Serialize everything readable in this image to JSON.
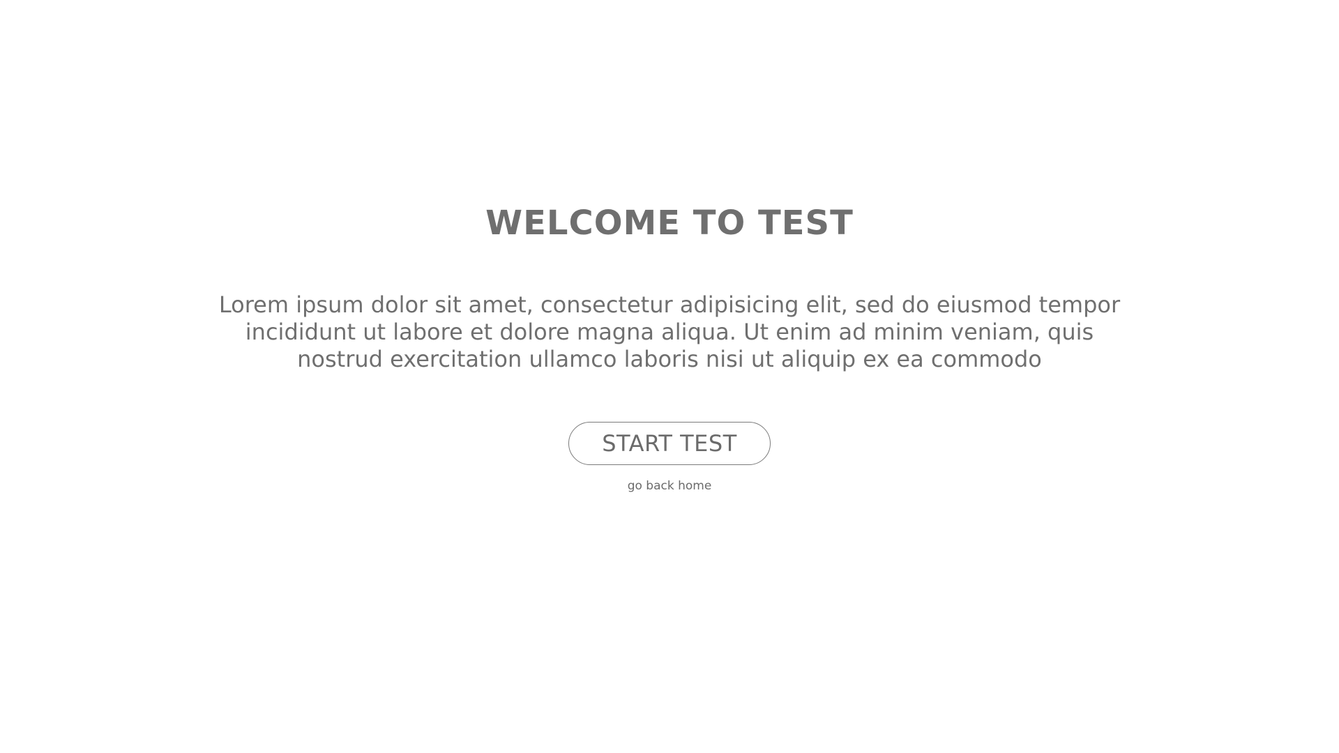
{
  "welcome": {
    "title": "WELCOME TO TEST",
    "intro": "Lorem ipsum dolor sit amet, consectetur adipisicing elit, sed do eiusmod tempor incididunt ut labore et dolore magna aliqua. Ut enim ad minim veniam, quis nostrud exercitation ullamco laboris nisi ut aliquip ex ea commodo"
  },
  "actions": {
    "start_label": "START TEST",
    "home_link_label": "go back home"
  },
  "colors": {
    "text": "#6b6b6b",
    "background": "#ffffff",
    "button_border": "#7a7a7a"
  }
}
